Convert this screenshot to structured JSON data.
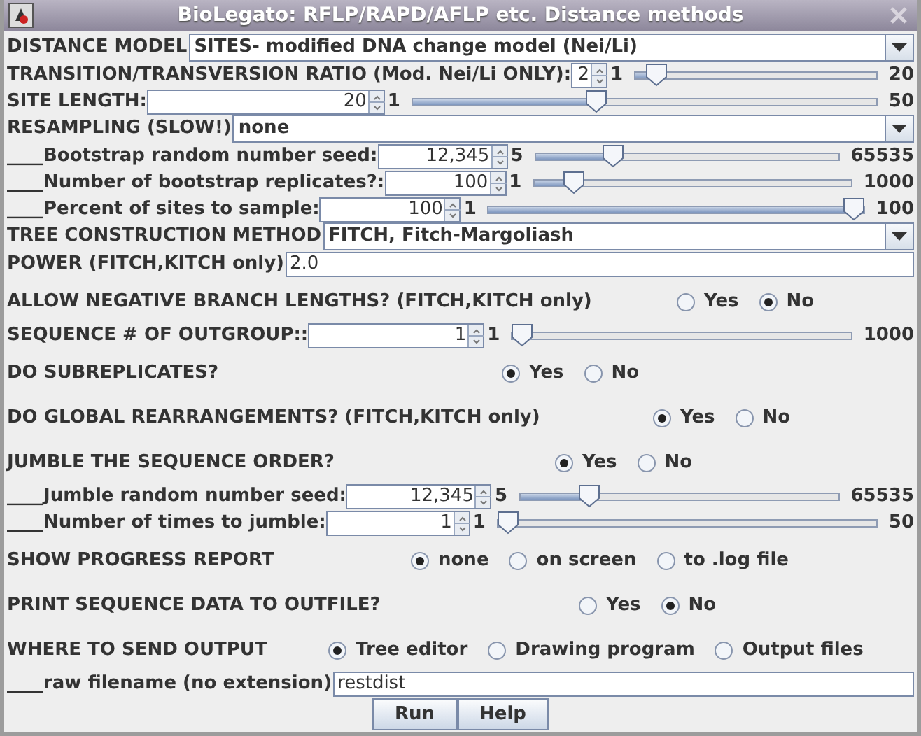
{
  "window": {
    "title": "BioLegato: RFLP/RAPD/AFLP etc. Distance methods"
  },
  "rows": [
    {
      "kind": "choice",
      "label": "DISTANCE MODEL",
      "value": "SITES- modified DNA change model (Nei/Li)"
    },
    {
      "kind": "spinner",
      "label": "TRANSITION/TRANSVERSION RATIO (Mod. Nei/Li ONLY):",
      "value": "2",
      "min": "1",
      "max": "20",
      "level": 0.05
    },
    {
      "kind": "spinner",
      "label": "SITE LENGTH:",
      "value": "20",
      "min": "1",
      "max": "50",
      "level": 0.39
    },
    {
      "kind": "choice",
      "label": "RESAMPLING (SLOW!)",
      "value": "none"
    },
    {
      "kind": "spinner",
      "label": "____Bootstrap random number seed:",
      "value": "12,345",
      "min": "5",
      "max": "65535",
      "level": 0.24
    },
    {
      "kind": "spinner",
      "label": "____Number of bootstrap replicates?:",
      "value": "100",
      "min": "1",
      "max": "1000",
      "level": 0.1
    },
    {
      "kind": "spinner",
      "label": "____Percent of sites to sample:",
      "value": "100",
      "min": "1",
      "max": "100",
      "level": 1
    },
    {
      "kind": "choice",
      "label": "TREE CONSTRUCTION METHOD",
      "value": "FITCH, Fitch-Margoliash"
    },
    {
      "kind": "text",
      "label": "POWER (FITCH,KITCH only)",
      "value": "2.0"
    },
    {
      "kind": "radio",
      "label": "ALLOW NEGATIVE BRANCH LENGTHS? (FITCH,KITCH only)",
      "options": [
        {
          "label": "Yes",
          "selected": false
        },
        {
          "label": "No",
          "selected": true
        }
      ]
    },
    {
      "kind": "spinner",
      "label": "SEQUENCE # OF OUTGROUP::",
      "value": "1",
      "min": "1",
      "max": "1000",
      "level": 0
    },
    {
      "kind": "radio",
      "label": "DO SUBREPLICATES?",
      "options": [
        {
          "label": "Yes",
          "selected": true
        },
        {
          "label": "No",
          "selected": false
        }
      ]
    },
    {
      "kind": "radio",
      "label": "DO GLOBAL REARRANGEMENTS?  (FITCH,KITCH only)",
      "options": [
        {
          "label": "Yes",
          "selected": true
        },
        {
          "label": "No",
          "selected": false
        }
      ]
    },
    {
      "kind": "radio",
      "label": "JUMBLE THE SEQUENCE ORDER?",
      "options": [
        {
          "label": "Yes",
          "selected": true
        },
        {
          "label": "No",
          "selected": false
        }
      ]
    },
    {
      "kind": "spinner",
      "label": "____Jumble random number seed:",
      "value": "12,345",
      "min": "5",
      "max": "65535",
      "level": 0.2
    },
    {
      "kind": "spinner",
      "label": "____Number of times to jumble:",
      "value": "1",
      "min": "1",
      "max": "50",
      "level": 0
    },
    {
      "kind": "radio",
      "label": "SHOW PROGRESS REPORT",
      "options": [
        {
          "label": "none",
          "selected": true
        },
        {
          "label": "on screen",
          "selected": false
        },
        {
          "label": "to .log file",
          "selected": false
        }
      ]
    },
    {
      "kind": "radio",
      "label": "PRINT SEQUENCE DATA TO OUTFILE?",
      "options": [
        {
          "label": "Yes",
          "selected": false
        },
        {
          "label": "No",
          "selected": true
        }
      ]
    },
    {
      "kind": "radio",
      "label": "WHERE TO SEND OUTPUT",
      "options": [
        {
          "label": "Tree editor",
          "selected": true
        },
        {
          "label": "Drawing program",
          "selected": false
        },
        {
          "label": "Output files",
          "selected": false
        }
      ]
    },
    {
      "kind": "text",
      "label": "____raw filename (no extension)",
      "value": "restdist"
    }
  ],
  "buttons": [
    "Run",
    "Help"
  ]
}
